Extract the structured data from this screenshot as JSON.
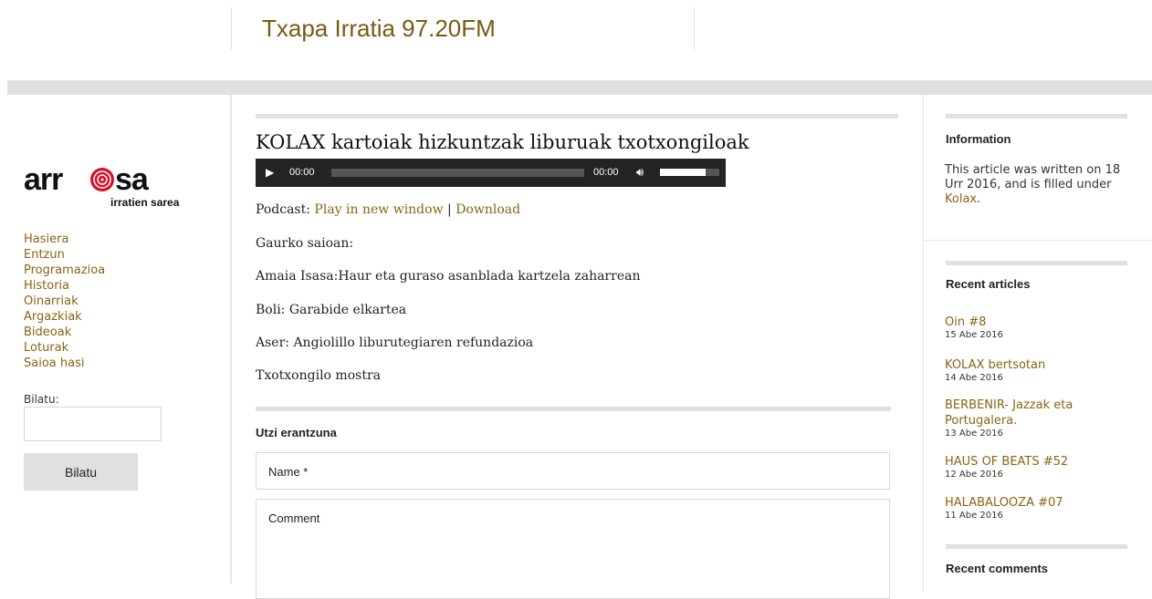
{
  "header": {
    "site_title": "Txapa Irratia 97.20FM"
  },
  "sidebar": {
    "logo_text": "arrosa",
    "logo_subtext": "irratien sarea",
    "nav": [
      "Hasiera",
      "Entzun",
      "Programazioa",
      "Historia",
      "Oinarriak",
      "Argazkiak",
      "Bideoak",
      "Loturak",
      "Saioa hasi"
    ],
    "search_label": "Bilatu:",
    "search_value": "",
    "search_button": "Bilatu"
  },
  "post": {
    "title": "KOLAX kartoiak hizkuntzak liburuak txotxongiloak",
    "player": {
      "current": "00:00",
      "duration": "00:00",
      "progress": 0,
      "volume": 0.77
    },
    "podcast_label": "Podcast:",
    "play_link": "Play in new window",
    "separator": "|",
    "download_link": "Download",
    "paragraphs": [
      "Gaurko saioan:",
      "Amaia Isasa:Haur eta guraso asanblada kartzela zaharrean",
      "Boli: Garabide elkartea",
      "Aser: Angiolillo liburutegiaren refundazioa",
      "Txotxongilo mostra"
    ]
  },
  "reply": {
    "title": "Utzi erantzuna",
    "name_placeholder": "Name *",
    "comment_placeholder": "Comment"
  },
  "right": {
    "info_heading": "Information",
    "info_text_1": "This article was written on 18 Urr 2016, and is filled under",
    "info_link": "Kolax",
    "info_end": ".",
    "recent_heading": "Recent articles",
    "recent": [
      {
        "title": "Oin #8",
        "date": "15 Abe 2016"
      },
      {
        "title": "KOLAX bertsotan",
        "date": "14 Abe 2016"
      },
      {
        "title": "BERBENIR- Jazzak eta Portugalera.",
        "date": "13 Abe 2016"
      },
      {
        "title": "HAUS OF BEATS #52",
        "date": "12 Abe 2016"
      },
      {
        "title": "HALABALOOZA #07",
        "date": "11 Abe 2016"
      }
    ],
    "comments_heading": "Recent comments"
  },
  "colors": {
    "link": "#8a6412",
    "title": "#7a5a12",
    "rule": "#e0e0e0",
    "player": "#232323"
  }
}
